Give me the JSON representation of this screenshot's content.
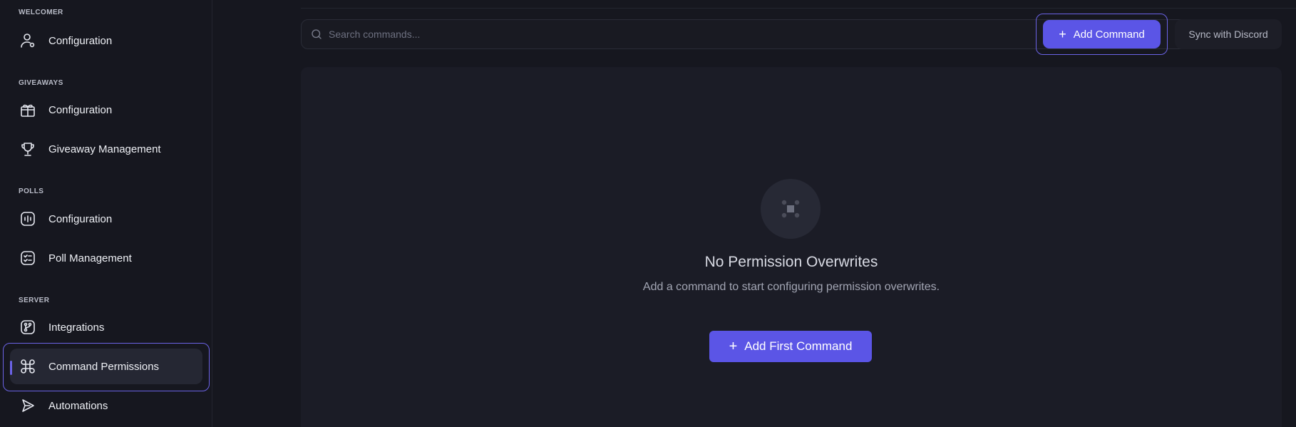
{
  "sidebar": {
    "sections": [
      {
        "label": "WELCOMER",
        "items": [
          {
            "label": "Configuration",
            "icon": "user-settings-icon"
          }
        ]
      },
      {
        "label": "GIVEAWAYS",
        "items": [
          {
            "label": "Configuration",
            "icon": "gift-icon"
          },
          {
            "label": "Giveaway Management",
            "icon": "trophy-icon"
          }
        ]
      },
      {
        "label": "POLLS",
        "items": [
          {
            "label": "Configuration",
            "icon": "poll-icon"
          },
          {
            "label": "Poll Management",
            "icon": "checklist-icon"
          }
        ]
      },
      {
        "label": "SERVER",
        "items": [
          {
            "label": "Integrations",
            "icon": "integration-icon"
          },
          {
            "label": "Command Permissions",
            "icon": "command-icon",
            "active": true
          },
          {
            "label": "Automations",
            "icon": "send-icon"
          }
        ]
      }
    ]
  },
  "toolbar": {
    "search_placeholder": "Search commands...",
    "add_command_label": "Add Command",
    "sync_label": "Sync with Discord"
  },
  "empty_state": {
    "icon": "command-icon",
    "title": "No Permission Overwrites",
    "description": "Add a command to start configuring permission overwrites.",
    "button_label": "Add First Command"
  },
  "colors": {
    "accent": "#5b55e6",
    "background": "#16171f",
    "panel": "#1b1c26"
  }
}
